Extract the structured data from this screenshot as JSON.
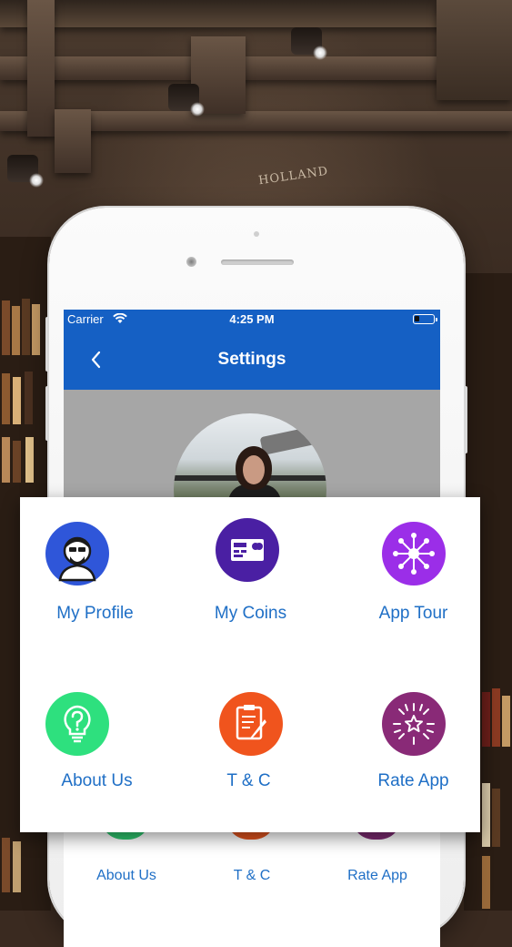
{
  "statusbar": {
    "carrier": "Carrier",
    "time": "4:25 PM"
  },
  "navbar": {
    "title": "Settings"
  },
  "menu": [
    {
      "label": "My Profile",
      "icon": "profile-icon",
      "color": "#2f56d9"
    },
    {
      "label": "My Coins",
      "icon": "card-icon",
      "color": "#4a1fa3"
    },
    {
      "label": "App Tour",
      "icon": "network-icon",
      "color": "#9b2ee8"
    },
    {
      "label": "About Us",
      "icon": "question-bulb-icon",
      "color": "#2ee07e"
    },
    {
      "label": "T & C",
      "icon": "document-edit-icon",
      "color": "#f0541d"
    },
    {
      "label": "Rate App",
      "icon": "fireworks-star-icon",
      "color": "#892a77"
    }
  ],
  "bottom_row": [
    {
      "label": "About Us",
      "color": "#2ec66f"
    },
    {
      "label": "T & C",
      "color": "#e0531e"
    },
    {
      "label": "Rate App",
      "color": "#7d2a72"
    }
  ],
  "background": {
    "sign": "HOLLAND"
  }
}
